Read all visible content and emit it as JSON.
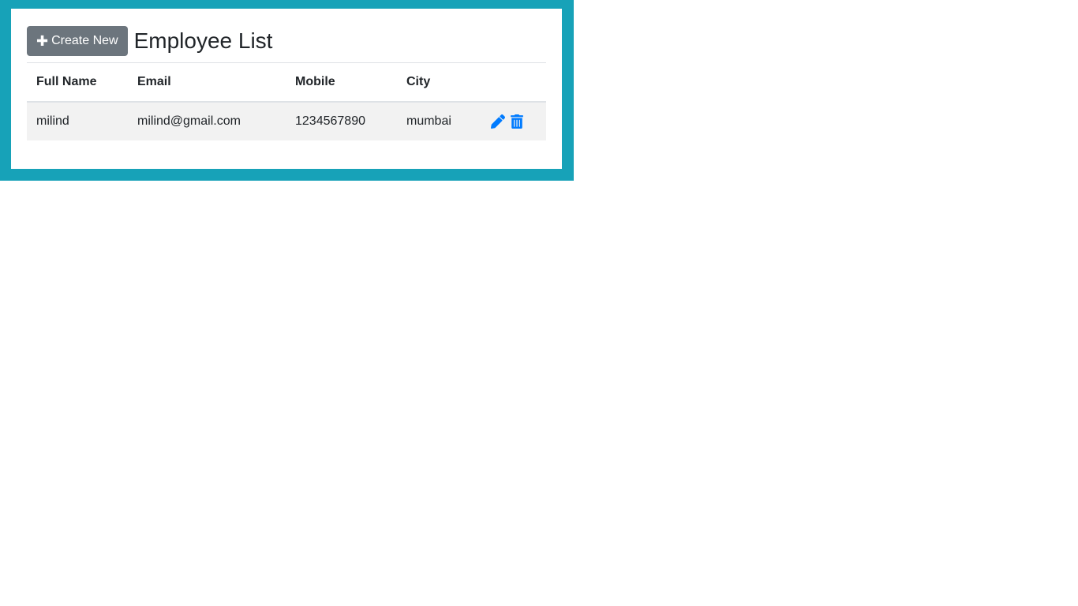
{
  "colors": {
    "frame_background": "#17a2b8",
    "button_background": "#6c757d",
    "icon_color": "#007bff",
    "row_stripe": "#f2f2f2"
  },
  "header": {
    "create_button_label": "Create New",
    "create_button_icon": "plus-icon",
    "title": "Employee List"
  },
  "table": {
    "columns": [
      "Full Name",
      "Email",
      "Mobile",
      "City",
      ""
    ],
    "rows": [
      {
        "full_name": "milind",
        "email": "milind@gmail.com",
        "mobile": "1234567890",
        "city": "mumbai",
        "actions": [
          "pencil-icon",
          "trash-icon"
        ]
      }
    ]
  }
}
